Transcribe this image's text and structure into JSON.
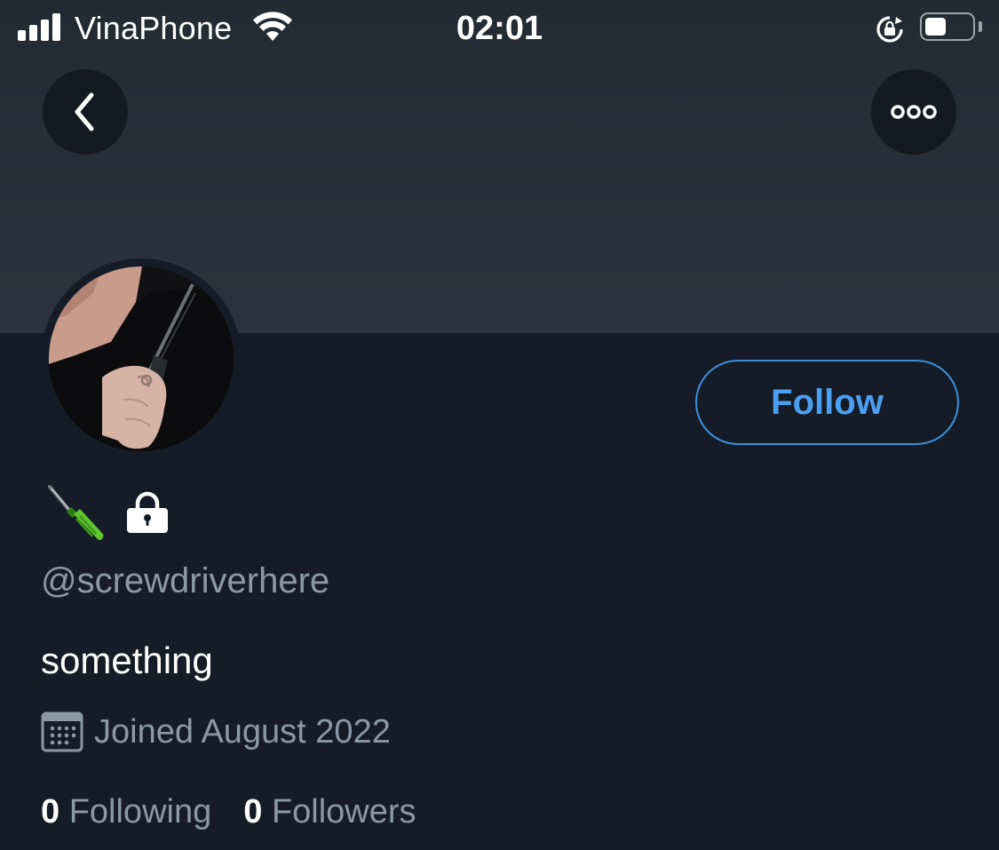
{
  "status_bar": {
    "carrier": "VinaPhone",
    "time": "02:01",
    "signal_bars": 4,
    "battery_level": 0.45
  },
  "nav": {
    "back_icon": "chevron-left-icon",
    "more_icon": "more-horizontal-icon"
  },
  "profile": {
    "display_name_icons": [
      "screwdriver-emoji",
      "lock-icon"
    ],
    "handle": "@screwdriverhere",
    "bio": "something",
    "joined": "Joined August 2022",
    "following_count": "0",
    "following_label": "Following",
    "followers_count": "0",
    "followers_label": "Followers",
    "follow_button_label": "Follow"
  },
  "colors": {
    "accent": "#4b9ff0",
    "background": "#151c27",
    "banner": "#2b333e",
    "secondary_text": "#8b98a5"
  }
}
